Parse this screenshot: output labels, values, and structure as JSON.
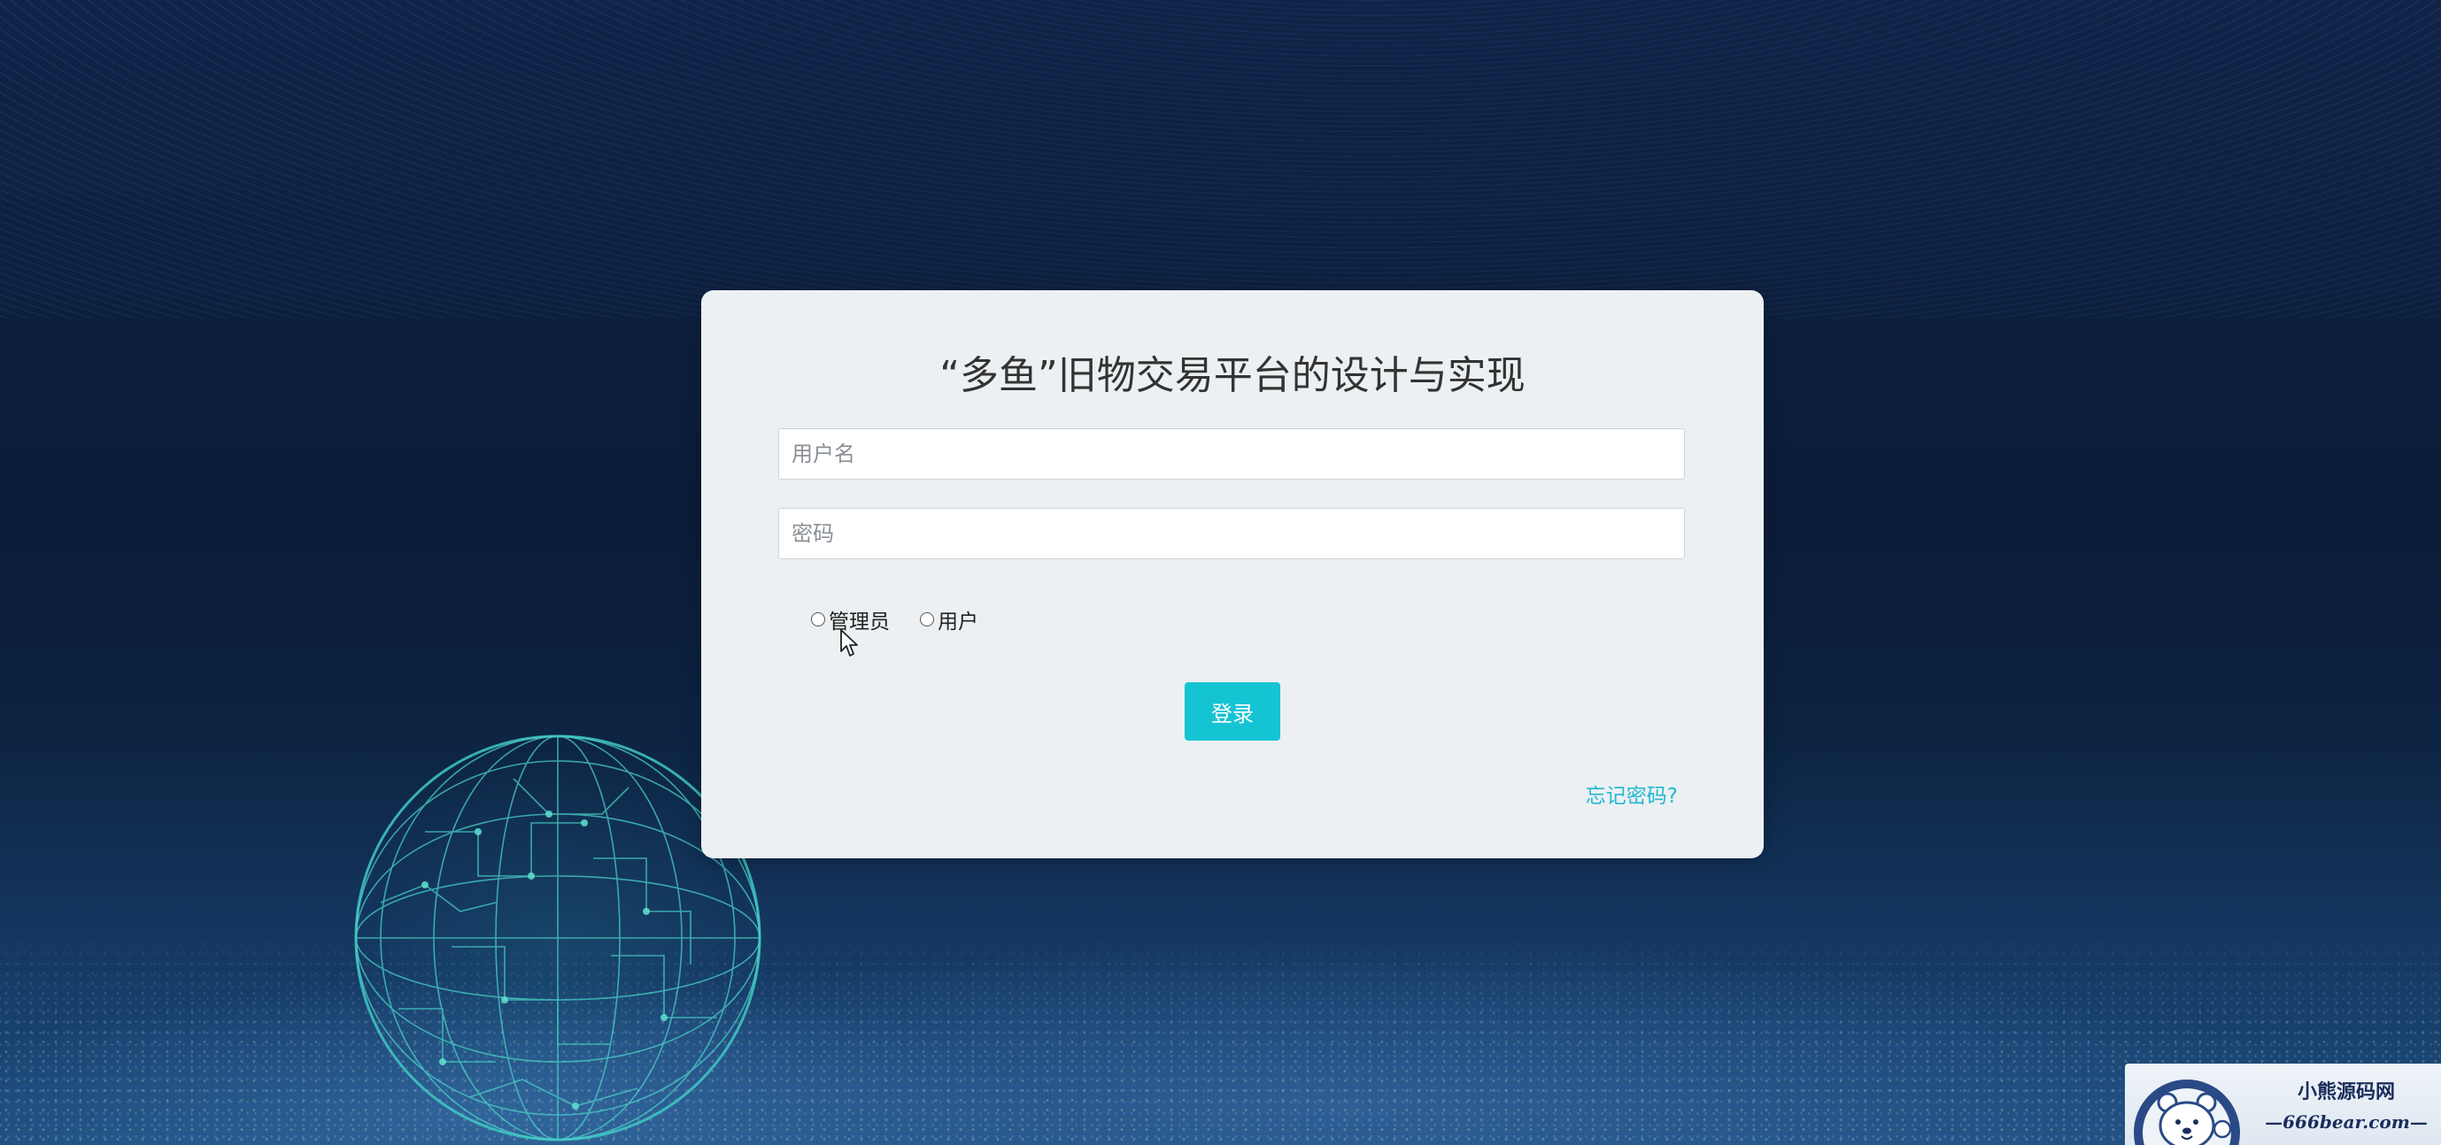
{
  "page": {
    "title": "“多鱼”旧物交易平台的设计与实现"
  },
  "login_form": {
    "username_placeholder": "用户名",
    "password_placeholder": "密码",
    "roles": [
      {
        "label": "管理员",
        "selected": false
      },
      {
        "label": "用户",
        "selected": false
      }
    ],
    "login_button": "登录",
    "forgot_password": "忘记密码?"
  },
  "watermark": {
    "line1": "小熊源码网",
    "line2": "—666bear.com—"
  },
  "colors": {
    "background_top": "#0f2447",
    "background_bottom": "#1f4f80",
    "card_bg": "#ecf0f2",
    "accent": "#15c4d3",
    "link": "#23b8d0",
    "title_text": "#333333"
  },
  "icons": {
    "globe": "globe-icon",
    "cursor": "mouse-pointer-icon",
    "bear_logo": "bear-logo-icon"
  }
}
